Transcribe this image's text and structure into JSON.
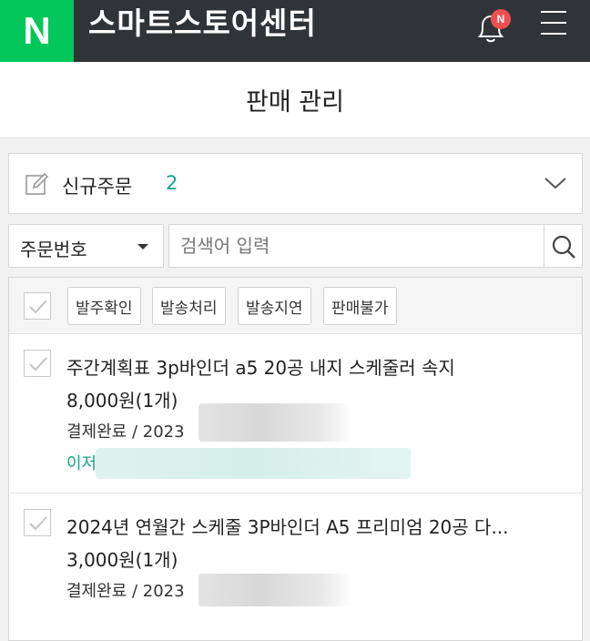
{
  "header": {
    "logo_letter": "N",
    "app_title": "스마트스토어센터",
    "notification_badge": "N"
  },
  "page": {
    "title": "판매 관리"
  },
  "status_filter": {
    "label": "신규주문",
    "count": "2"
  },
  "search": {
    "field_select": "주문번호",
    "placeholder": "검색어 입력"
  },
  "toolbar": {
    "actions": [
      "발주확인",
      "발송처리",
      "발송지연",
      "판매불가"
    ]
  },
  "orders": [
    {
      "name": "주간계획표 3p바인더 a5 20공 내지 스케줄러 속지",
      "price": "8,000원(1개)",
      "status": "결제완료 / 2023",
      "buyer": "이저"
    },
    {
      "name": "2024년 연월간 스케줄 3P바인더 A5 프리미엄 20공 다...",
      "price": "3,000원(1개)",
      "status": "결제완료 / 2023"
    }
  ],
  "colors": {
    "brand_green": "#03c75a",
    "topbar": "#2f3438",
    "accent_teal": "#15a38c",
    "badge_red": "#f04e4e"
  }
}
